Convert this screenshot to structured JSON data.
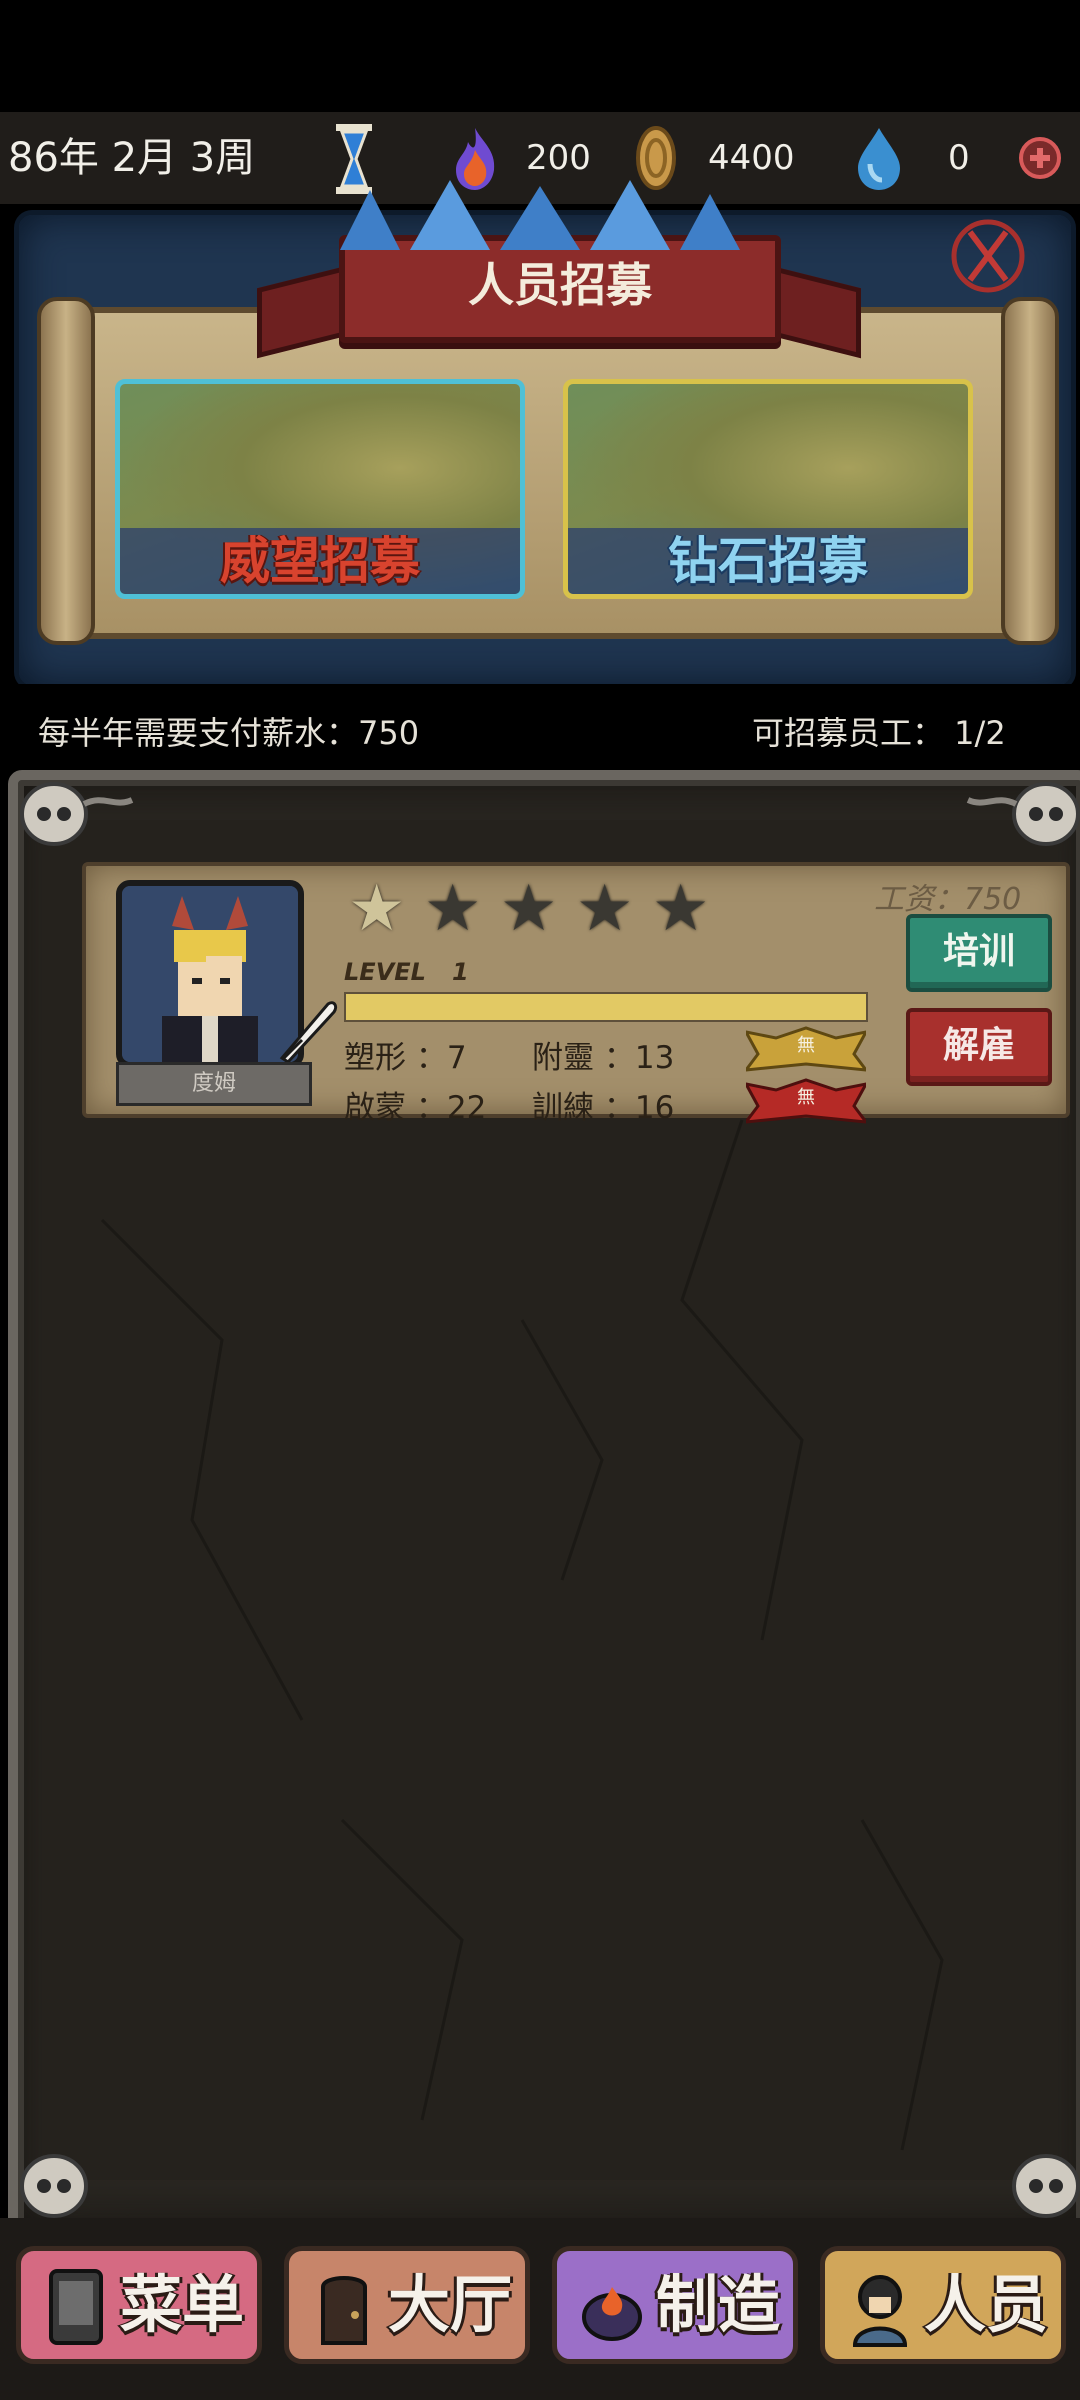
{
  "status_bar": {
    "date": "86年 2月 3周",
    "flame_count": "200",
    "coin_count": "4400",
    "drop_count": "0"
  },
  "recruit_panel": {
    "title": "人员招募",
    "prestige_recruit_label": "威望招募",
    "diamond_recruit_label": "钻石招募"
  },
  "info": {
    "salary_note": "每半年需要支付薪水：750",
    "capacity_note": "可招募员工：  1/2"
  },
  "staff": [
    {
      "name": "度姆",
      "stars_total": 5,
      "stars_filled": 1,
      "salary": "工资：750",
      "level_label": "LEVEL",
      "level": "1",
      "level_progress": 1.0,
      "stats": {
        "shaping": "塑形 ：7",
        "attach_spirit": "附靈 ：13",
        "enlighten": "啟蒙 ：22",
        "train": "訓練 ：16"
      },
      "trait_gold": "無",
      "trait_red": "無",
      "train_button": "培训",
      "fire_button": "解雇"
    }
  ],
  "nav": {
    "menu": "菜单",
    "hall": "大厅",
    "craft": "制造",
    "staff": "人员"
  },
  "colors": {
    "train_button": "#2f8c74",
    "fire_button": "#a8302d",
    "level_fill": "#e2c964"
  }
}
